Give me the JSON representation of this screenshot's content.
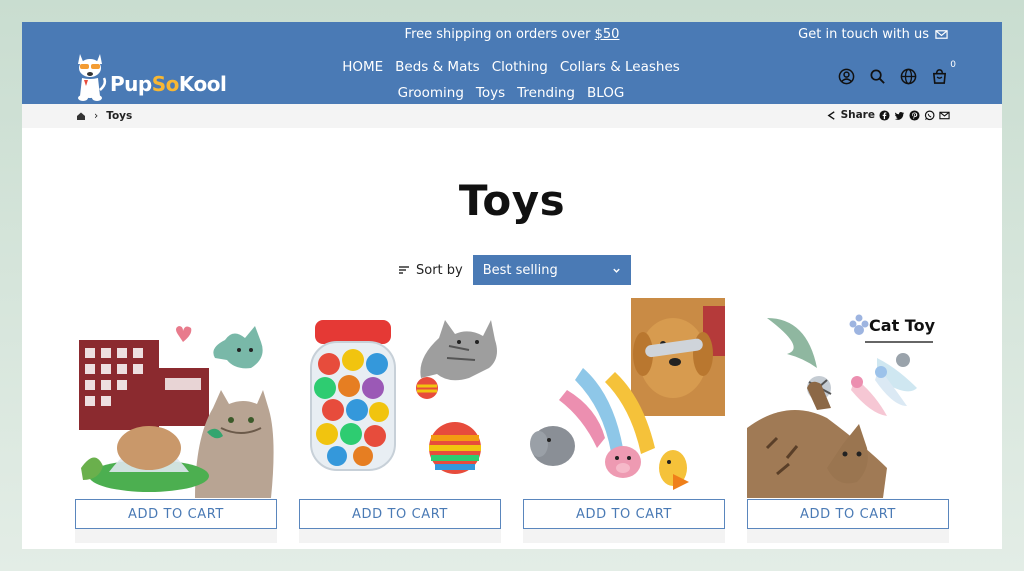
{
  "header": {
    "announcement_prefix": "Free shipping on orders over ",
    "announcement_link": "$50",
    "contact_label": "Get in touch with us",
    "logo": {
      "pup": "Pup",
      "so": "So",
      "kool": "Kool"
    },
    "nav": [
      "HOME",
      "Beds & Mats",
      "Clothing",
      "Collars & Leashes",
      "Grooming",
      "Toys",
      "Trending",
      "BLOG"
    ],
    "cart_count": "0",
    "icons": [
      "user-icon",
      "search-icon",
      "globe-icon",
      "cart-icon"
    ]
  },
  "breadcrumb": {
    "current": "Toys"
  },
  "share": {
    "label": "Share",
    "icons": [
      "facebook-icon",
      "twitter-icon",
      "pinterest-icon",
      "whatsapp-icon",
      "email-icon"
    ]
  },
  "page": {
    "title": "Toys"
  },
  "sort": {
    "label": "Sort by",
    "selected": "Best selling"
  },
  "products": [
    {
      "button": "ADD TO CART"
    },
    {
      "button": "ADD TO CART"
    },
    {
      "button": "ADD TO CART"
    },
    {
      "button": "ADD TO CART",
      "image_text": "Cat Toy"
    }
  ],
  "colors": {
    "brand": "#4a7ab5",
    "accent": "#f7b733"
  }
}
